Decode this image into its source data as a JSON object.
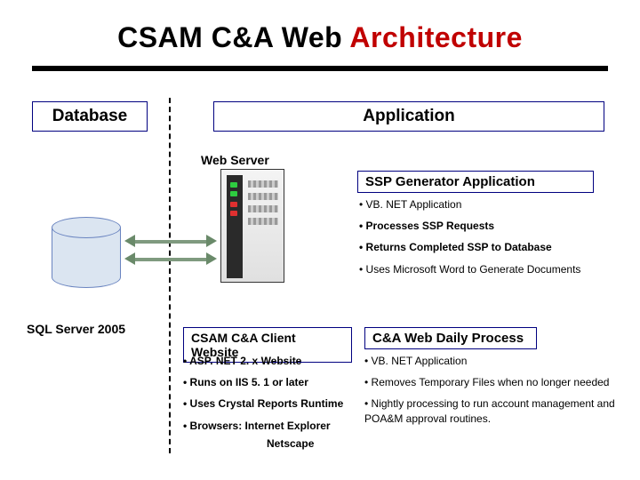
{
  "title_prefix": "CSAM C&A Web ",
  "title_highlight": "Architecture",
  "database_label": "Database",
  "application_label": "Application",
  "web_server_label": "Web Server",
  "sql_label": "SQL Server 2005",
  "ssp": {
    "heading": "SSP Generator Application",
    "items": [
      "• VB. NET Application",
      "• Processes SSP Requests",
      "• Returns Completed SSP to Database",
      "• Uses Microsoft Word to Generate Documents"
    ]
  },
  "client": {
    "heading": "CSAM C&A Client Website",
    "items": [
      "• ASP. NET 2. x Website",
      "• Runs on IIS 5. 1 or later",
      "• Uses Crystal Reports Runtime",
      "• Browsers: Internet Explorer"
    ],
    "netscape": "Netscape"
  },
  "daily": {
    "heading": "C&A Web Daily Process",
    "items": [
      "• VB. NET Application",
      "• Removes Temporary Files when no longer needed",
      "• Nightly processing to run account management and POA&M approval routines."
    ]
  }
}
